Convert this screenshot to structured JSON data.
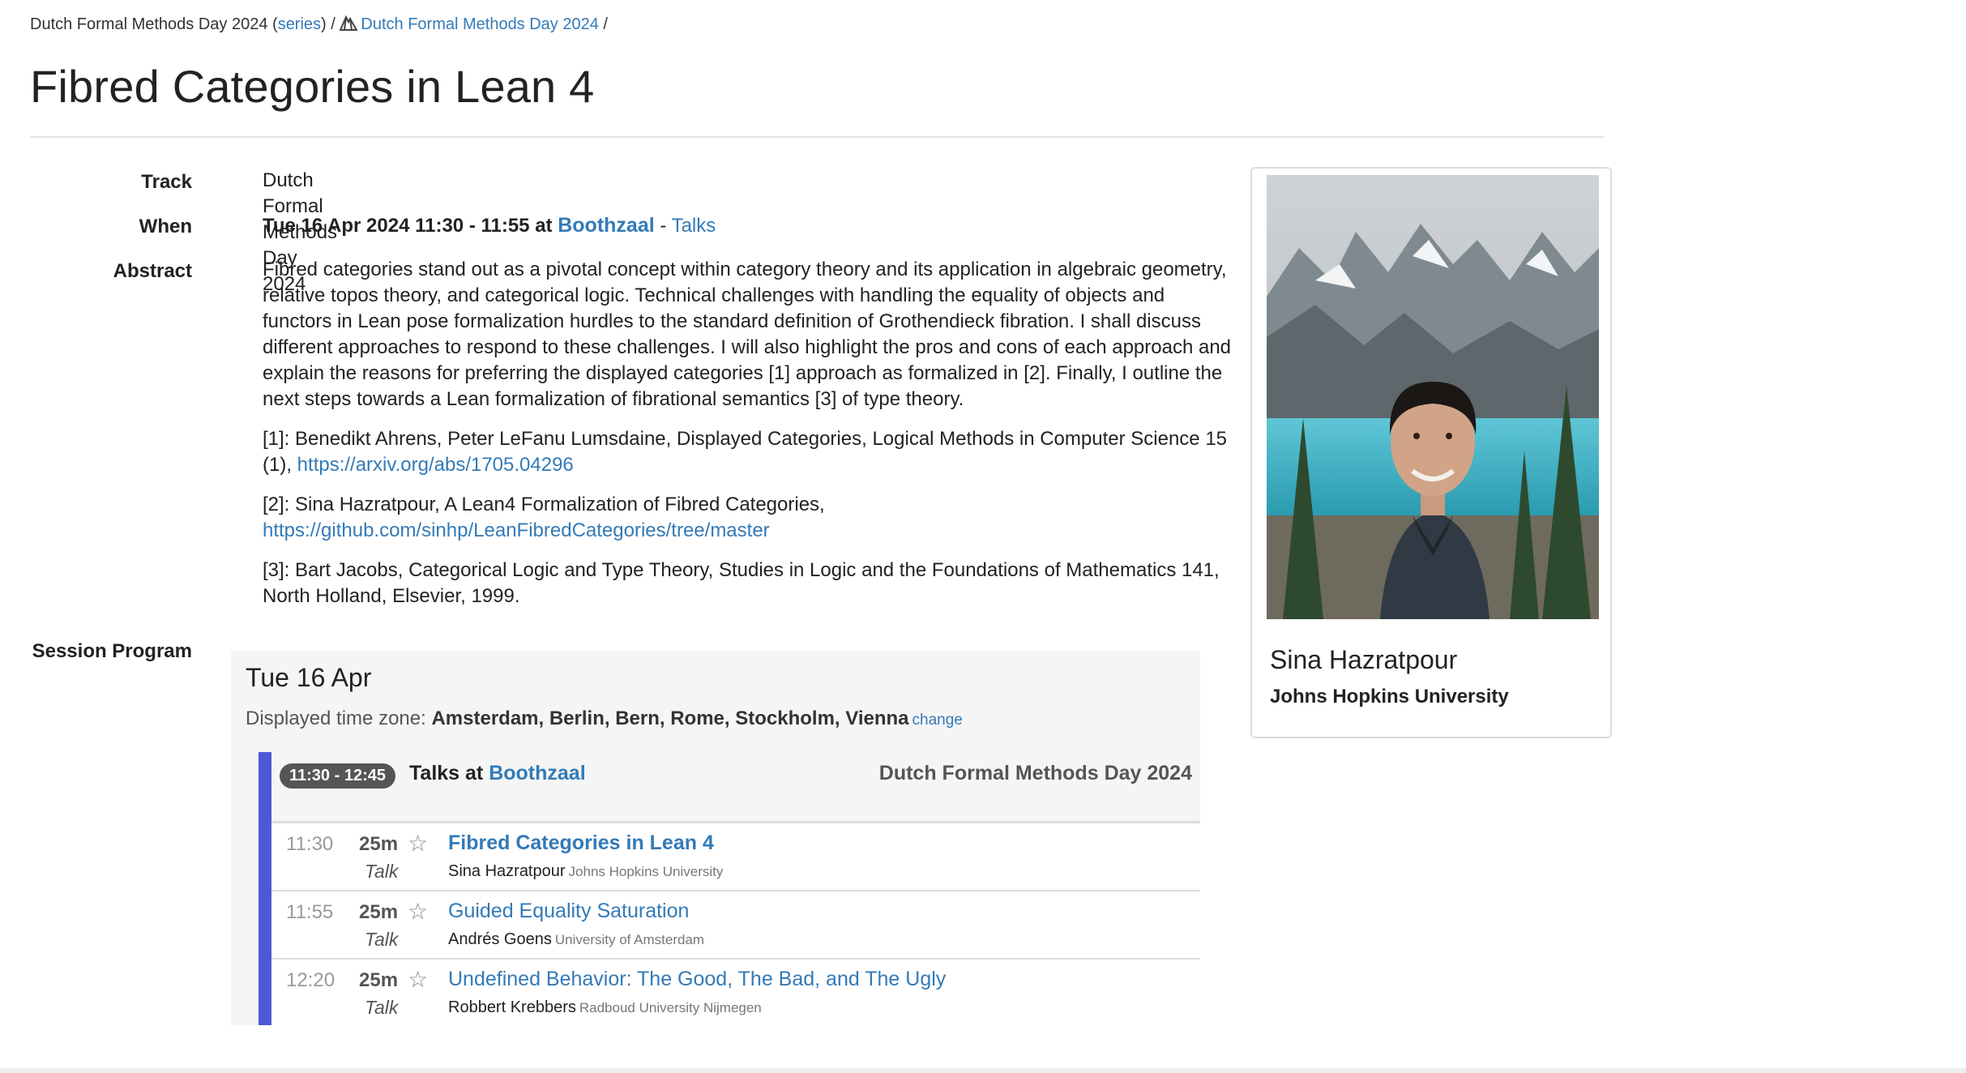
{
  "breadcrumb": {
    "event_name": "Dutch Formal Methods Day 2024",
    "series_open": " (",
    "series_link": "series",
    "series_close": ")",
    "sep1": " / ",
    "event_link": "Dutch Formal Methods Day 2024",
    "sep2": " /"
  },
  "page_title": "Fibred Categories in Lean 4",
  "track": {
    "label": "Track",
    "value": "Dutch Formal Methods Day 2024"
  },
  "when": {
    "label": "When",
    "datetime": "Tue 16 Apr 2024 11:30 - 11:55 at ",
    "room": "Boothzaal",
    "dash": " - ",
    "session": "Talks"
  },
  "abstract": {
    "label": "Abstract",
    "text": "Fibred categories stand out as a pivotal concept within category theory and its application in algebraic geometry, relative topos theory, and categorical logic. Technical challenges with handling the equality of objects and functors in Lean pose formalization hurdles to the standard definition of Grothendieck fibration. I shall discuss different approaches to respond to these challenges. I will also highlight the pros and cons of each approach and explain the reasons for preferring the displayed categories [1] approach as formalized in [2]. Finally, I outline the next steps towards a Lean formalization of fibrational semantics [3] of type theory.",
    "ref1_text": "[1]: Benedikt Ahrens, Peter LeFanu Lumsdaine, Displayed Categories, Logical Methods in Computer Science 15 (1), ",
    "ref1_link": "https://arxiv.org/abs/1705.04296",
    "ref2_text": "[2]: Sina Hazratpour, A Lean4 Formalization of Fibred Categories,",
    "ref2_link": "https://github.com/sinhp/LeanFibredCategories/tree/master",
    "ref3_text": "[3]: Bart Jacobs, Categorical Logic and Type Theory, Studies in Logic and the Foundations of Mathematics 141, North Holland, Elsevier, 1999."
  },
  "session_program": {
    "label": "Session Program",
    "day": "Tue 16 Apr",
    "tz_label": "Displayed time zone: ",
    "tz_value": "Amsterdam, Berlin, Bern, Rome, Stockholm, Vienna",
    "tz_change": "change",
    "slot": {
      "time": "11:30 - 12:45",
      "title_prefix": "Talks at ",
      "room": "Boothzaal",
      "track": "Dutch Formal Methods Day 2024"
    },
    "talks": [
      {
        "start": "11:30",
        "duration": "25m",
        "type": "Talk",
        "title": "Fibred Categories in Lean 4",
        "speaker": "Sina Hazratpour",
        "affiliation": "Johns Hopkins University"
      },
      {
        "start": "11:55",
        "duration": "25m",
        "type": "Talk",
        "title": "Guided Equality Saturation",
        "speaker": "Andrés Goens",
        "affiliation": "University of Amsterdam"
      },
      {
        "start": "12:20",
        "duration": "25m",
        "type": "Talk",
        "title": "Undefined Behavior: The Good, The Bad, and The Ugly",
        "speaker": "Robbert Krebbers",
        "affiliation": "Radboud University Nijmegen"
      }
    ]
  },
  "speaker_card": {
    "name": "Sina Hazratpour",
    "affiliation": "Johns Hopkins University"
  },
  "icons": {
    "star": "star-icon",
    "mountain": "mountain-icon"
  },
  "colors": {
    "link": "#337ab7",
    "session_bar": "#4b59d6",
    "pill": "#555555"
  }
}
